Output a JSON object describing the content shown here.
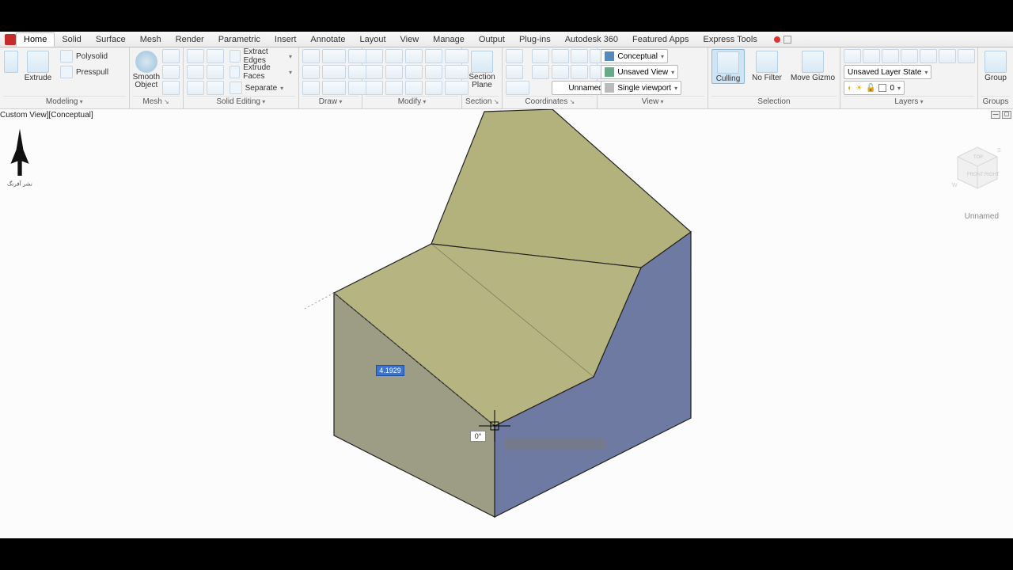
{
  "menu": {
    "tabs": [
      "Home",
      "Solid",
      "Surface",
      "Mesh",
      "Render",
      "Parametric",
      "Insert",
      "Annotate",
      "Layout",
      "View",
      "Manage",
      "Output",
      "Plug-ins",
      "Autodesk 360",
      "Featured Apps",
      "Express Tools"
    ],
    "active": "Home"
  },
  "ribbon": {
    "modeling": {
      "title": "Modeling",
      "extrude": "Extrude",
      "polysolid": "Polysolid",
      "presspull": "Presspull"
    },
    "mesh": {
      "title": "Mesh",
      "smooth": "Smooth Object"
    },
    "solidedit": {
      "title": "Solid Editing",
      "extract_edges": "Extract Edges",
      "extrude_faces": "Extrude Faces",
      "separate": "Separate"
    },
    "draw": {
      "title": "Draw"
    },
    "modify": {
      "title": "Modify"
    },
    "section": {
      "title": "Section",
      "plane": "Section Plane"
    },
    "coordinates": {
      "title": "Coordinates",
      "unnamed": "Unnamed"
    },
    "view": {
      "title": "View",
      "visual_style": "Conceptual",
      "saved_view": "Unsaved View",
      "viewport": "Single viewport"
    },
    "selection": {
      "title": "Selection",
      "culling": "Culling",
      "nofilter": "No Filter",
      "gizmo": "Move Gizmo"
    },
    "layers": {
      "title": "Layers",
      "state": "Unsaved Layer State",
      "current": "0"
    },
    "groups": {
      "title": "Groups",
      "group": "Group"
    }
  },
  "viewport": {
    "label": "Custom View][Conceptual]",
    "cube_label": "Unnamed",
    "dim_value": "4.1929",
    "angle_value": "0°"
  }
}
